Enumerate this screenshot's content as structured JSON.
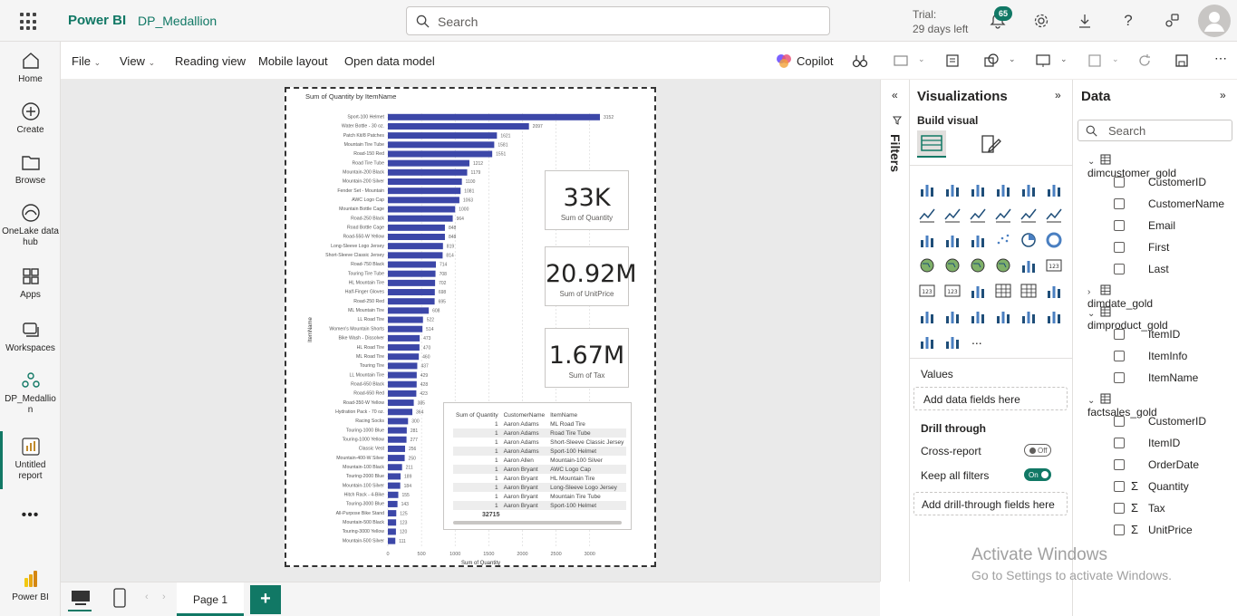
{
  "header": {
    "brand": "Power BI",
    "workspace": "DP_Medallion",
    "search_placeholder": "Search",
    "trial_line1": "Trial:",
    "trial_line2": "29 days left",
    "notification_count": "65"
  },
  "leftnav": [
    {
      "label": "Home",
      "icon": "home-icon"
    },
    {
      "label": "Create",
      "icon": "create-icon"
    },
    {
      "label": "Browse",
      "icon": "folder-icon"
    },
    {
      "label": "OneLake data hub",
      "icon": "onelake-icon"
    },
    {
      "label": "Apps",
      "icon": "apps-icon"
    },
    {
      "label": "Workspaces",
      "icon": "workspaces-icon"
    },
    {
      "label": "DP_Medallion",
      "icon": "workspace-icon"
    },
    {
      "label": "Untitled report",
      "icon": "report-icon"
    },
    {
      "label": "Power BI",
      "icon": "powerbi-logo"
    }
  ],
  "ribbon": {
    "file": "File",
    "view": "View",
    "reading_view": "Reading view",
    "mobile_layout": "Mobile layout",
    "open_data_model": "Open data model",
    "copilot": "Copilot"
  },
  "report": {
    "kpis": [
      {
        "value": "33K",
        "label": "Sum of Quantity"
      },
      {
        "value": "20.92M",
        "label": "Sum of UnitPrice"
      },
      {
        "value": "1.67M",
        "label": "Sum of Tax"
      }
    ],
    "table": {
      "headers": [
        "Sum of Quantity",
        "CustomerName",
        "ItemName"
      ],
      "rows": [
        [
          "1",
          "Aaron Adams",
          "ML Road Tire"
        ],
        [
          "1",
          "Aaron Adams",
          "Road Tire Tube"
        ],
        [
          "1",
          "Aaron Adams",
          "Short-Sleeve Classic Jersey"
        ],
        [
          "1",
          "Aaron Adams",
          "Sport-100 Helmet"
        ],
        [
          "1",
          "Aaron Allen",
          "Mountain-100 Silver"
        ],
        [
          "1",
          "Aaron Bryant",
          "AWC Logo Cap"
        ],
        [
          "1",
          "Aaron Bryant",
          "HL Mountain Tire"
        ],
        [
          "1",
          "Aaron Bryant",
          "Long-Sleeve Logo Jersey"
        ],
        [
          "1",
          "Aaron Bryant",
          "Mountain Tire Tube"
        ],
        [
          "1",
          "Aaron Bryant",
          "Sport-100 Helmet"
        ]
      ],
      "total": "32715"
    }
  },
  "chart_data": {
    "type": "bar",
    "orientation": "horizontal",
    "title": "Sum of Quantity by ItemName",
    "xlabel": "Sum of Quantity",
    "ylabel": "ItemName",
    "xlim": [
      0,
      3300
    ],
    "xticks": [
      0,
      500,
      1000,
      1500,
      2000,
      2500,
      3000
    ],
    "categories": [
      "Sport-100 Helmet",
      "Water Bottle - 30 oz.",
      "Patch Kit/8 Patches",
      "Mountain Tire Tube",
      "Road-150 Red",
      "Road Tire Tube",
      "Mountain-200 Black",
      "Mountain-200 Silver",
      "Fender Set - Mountain",
      "AWC Logo Cap",
      "Mountain Bottle Cage",
      "Road-250 Black",
      "Road Bottle Cage",
      "Road-550-W Yellow",
      "Long-Sleeve Logo Jersey",
      "Short-Sleeve Classic Jersey",
      "Road-750 Black",
      "Touring Tire Tube",
      "HL Mountain Tire",
      "Half-Finger Gloves",
      "Road-250 Red",
      "ML Mountain Tire",
      "LL Road Tire",
      "Women's Mountain Shorts",
      "Bike Wash - Dissolver",
      "HL Road Tire",
      "ML Road Tire",
      "Touring Tire",
      "LL Mountain Tire",
      "Road-650 Black",
      "Road-650 Red",
      "Road-350-W Yellow",
      "Hydration Pack - 70 oz.",
      "Racing Socks",
      "Touring-1000 Blue",
      "Touring-1000 Yellow",
      "Classic Vest",
      "Mountain-400-W Silver",
      "Mountain-100 Black",
      "Touring-2000 Blue",
      "Mountain-100 Silver",
      "Hitch Rack - 4-Bike",
      "Touring-3000 Blue",
      "All-Purpose Bike Stand",
      "Mountain-500 Black",
      "Touring-3000 Yellow",
      "Mountain-500 Silver"
    ],
    "values": [
      3152,
      2097,
      1621,
      1581,
      1551,
      1212,
      1179,
      1100,
      1081,
      1063,
      1000,
      964,
      848,
      848,
      819,
      814,
      714,
      708,
      702,
      698,
      695,
      608,
      522,
      514,
      473,
      470,
      460,
      437,
      429,
      428,
      423,
      385,
      364,
      300,
      281,
      277,
      256,
      250,
      211,
      189,
      184,
      155,
      143,
      125,
      123,
      120,
      111
    ],
    "grid": true
  },
  "filters_label": "Filters",
  "viz_pane": {
    "title": "Visualizations",
    "build_visual": "Build visual",
    "values": "Values",
    "add_data": "Add data fields here",
    "drill_through": "Drill through",
    "cross_report": "Cross-report",
    "cross_report_state": "Off",
    "keep_all_filters": "Keep all filters",
    "keep_all_filters_state": "On",
    "add_drill": "Add drill-through fields here",
    "more": "..."
  },
  "data_pane": {
    "title": "Data",
    "search_placeholder": "Search",
    "tables": [
      {
        "name": "dimcustomer_gold",
        "expanded": true,
        "fields": [
          {
            "name": "CustomerID",
            "sigma": false
          },
          {
            "name": "CustomerName",
            "sigma": false
          },
          {
            "name": "Email",
            "sigma": false
          },
          {
            "name": "First",
            "sigma": false
          },
          {
            "name": "Last",
            "sigma": false
          }
        ]
      },
      {
        "name": "dimdate_gold",
        "expanded": false,
        "fields": []
      },
      {
        "name": "dimproduct_gold",
        "expanded": true,
        "fields": [
          {
            "name": "ItemID",
            "sigma": false
          },
          {
            "name": "ItemInfo",
            "sigma": false
          },
          {
            "name": "ItemName",
            "sigma": false
          }
        ]
      },
      {
        "name": "factsales_gold",
        "expanded": true,
        "fields": [
          {
            "name": "CustomerID",
            "sigma": false
          },
          {
            "name": "ItemID",
            "sigma": false
          },
          {
            "name": "OrderDate",
            "sigma": false
          },
          {
            "name": "Quantity",
            "sigma": true
          },
          {
            "name": "Tax",
            "sigma": true
          },
          {
            "name": "UnitPrice",
            "sigma": true
          }
        ]
      }
    ]
  },
  "bottom": {
    "page_tab": "Page 1",
    "add_page": "+"
  },
  "watermark": {
    "line1": "Activate Windows",
    "line2": "Go to Settings to activate Windows."
  },
  "colors": {
    "accent": "#117865",
    "bar": "#3c47a8",
    "toggle_on": "#117865"
  }
}
